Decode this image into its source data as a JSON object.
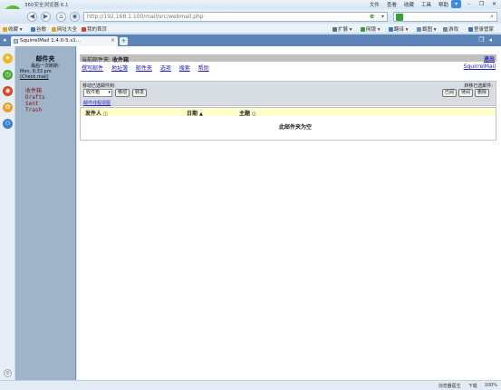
{
  "browser": {
    "title": "360安全浏览器 6.1",
    "menu": [
      "文件",
      "查看",
      "收藏",
      "工具",
      "帮助"
    ],
    "url": "http://192.168.1.100/mail/src/webmail.php",
    "bookmarks": [
      "收藏",
      "谷歌",
      "网址大全",
      "我的首页"
    ],
    "toolbar_right": [
      "扩展",
      "网银",
      "翻译",
      "截图",
      "游戏",
      "登录管家"
    ],
    "tab_label": "SquirrelMail 1.4.0-5.s1...",
    "status": [
      "浏览器医生",
      "下载",
      "100%"
    ]
  },
  "sidebar": {
    "heading": "邮件夹",
    "last_refresh_label": "最后一次刷新:",
    "last_refresh_time": "Mon, 6:33 pm",
    "check_mail": "(Check mail)",
    "folders": [
      "收件箱",
      "Drafts",
      "Sent",
      "Trash"
    ]
  },
  "main": {
    "current_folder_label": "当前邮件夹:",
    "current_folder": "收件箱",
    "logout": "退出",
    "nav": [
      "撰写邮件",
      "地址簿",
      "邮件夹",
      "选项",
      "搜索",
      "帮助"
    ],
    "brand_link": "SquirrelMail",
    "move_label": "移动已选邮件到:",
    "move_select": "收件箱",
    "move_button": "移动",
    "forward_button": "转发",
    "toggle_label": "转移已选邮件:",
    "read_button": "已阅",
    "unread_button": "待阅",
    "delete_button": "删除",
    "thread_view_link": "邮件线程视图",
    "columns": {
      "from": "发件人",
      "date": "日期",
      "subject": "主题"
    },
    "empty_message": "此邮件夹为空"
  }
}
